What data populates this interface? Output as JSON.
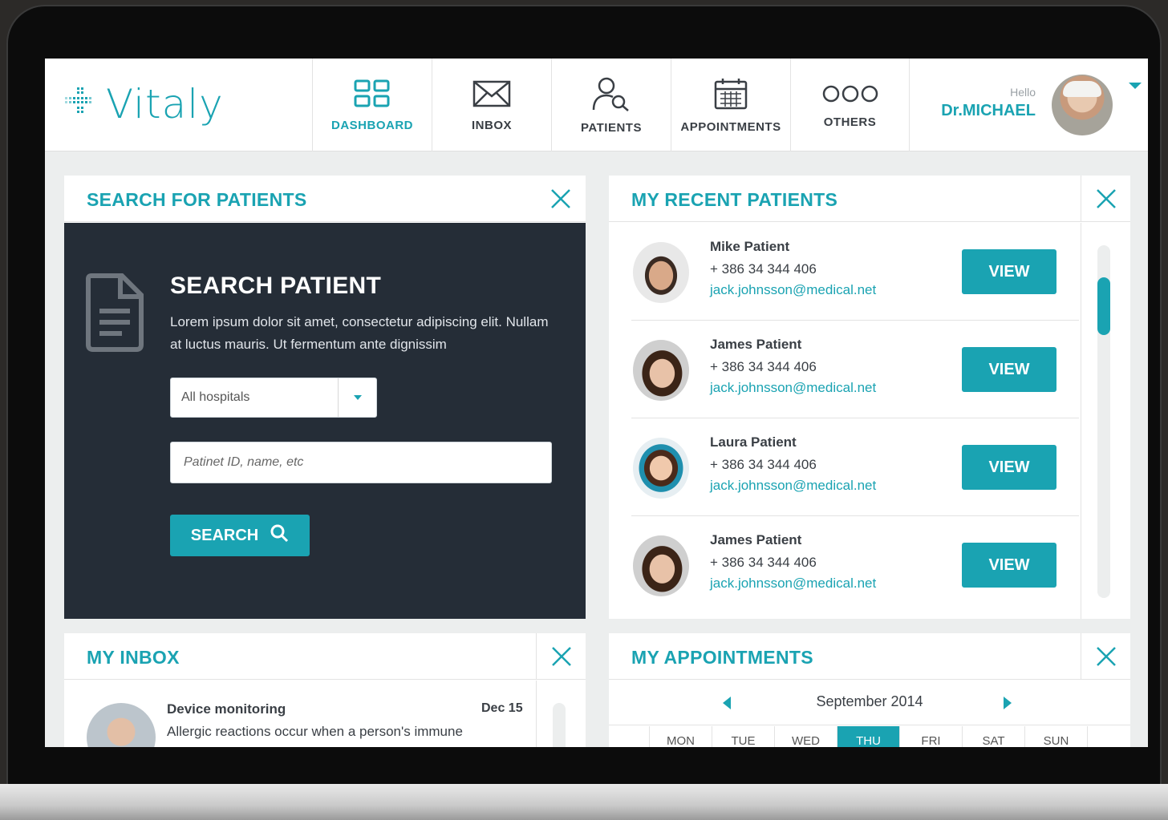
{
  "app": {
    "logo_text": "Vitaly"
  },
  "nav": [
    {
      "label": "DASHBOARD",
      "active": true,
      "icon": "grid-icon"
    },
    {
      "label": "INBOX",
      "active": false,
      "icon": "envelope-icon"
    },
    {
      "label": "PATIENTS",
      "active": false,
      "icon": "user-search-icon"
    },
    {
      "label": "APPOINTMENTS",
      "active": false,
      "icon": "calendar-icon"
    },
    {
      "label": "OTHERS",
      "active": false,
      "icon": "more-dots-icon"
    }
  ],
  "user": {
    "greeting": "Hello",
    "name": "Dr.MICHAEL"
  },
  "search_panel": {
    "title": "SEARCH FOR PATIENTS",
    "heading": "SEARCH PATIENT",
    "description": "Lorem ipsum dolor sit amet, consectetur adipiscing elit. Nullam at luctus mauris. Ut fermentum ante dignissim",
    "hospital_select": "All hospitals",
    "input_placeholder": "Patinet ID, name, etc",
    "button_label": "SEARCH"
  },
  "recent_patients": {
    "title": "MY RECENT PATIENTS",
    "view_label": "VIEW",
    "items": [
      {
        "name": "Mike Patient",
        "phone": "+ 386 34 344 406",
        "email": "jack.johnsson@medical.net"
      },
      {
        "name": "James Patient",
        "phone": "+ 386 34 344 406",
        "email": "jack.johnsson@medical.net"
      },
      {
        "name": "Laura Patient",
        "phone": "+ 386 34 344 406",
        "email": "jack.johnsson@medical.net"
      },
      {
        "name": "James Patient",
        "phone": "+ 386 34 344 406",
        "email": "jack.johnsson@medical.net"
      }
    ]
  },
  "inbox": {
    "title": "MY INBOX",
    "messages": [
      {
        "subject": "Device monitoring",
        "date": "Dec 15",
        "preview": "Allergic reactions occur when a person's immune"
      }
    ]
  },
  "appointments": {
    "title": "MY APPOINTMENTS",
    "month": "September 2014",
    "days": [
      "MON",
      "TUE",
      "WED",
      "THU",
      "FRI",
      "SAT",
      "SUN"
    ],
    "active_day": "THU"
  },
  "colors": {
    "accent": "#1aa3b2",
    "dark_panel": "#252d37",
    "text": "#3a3f45"
  }
}
